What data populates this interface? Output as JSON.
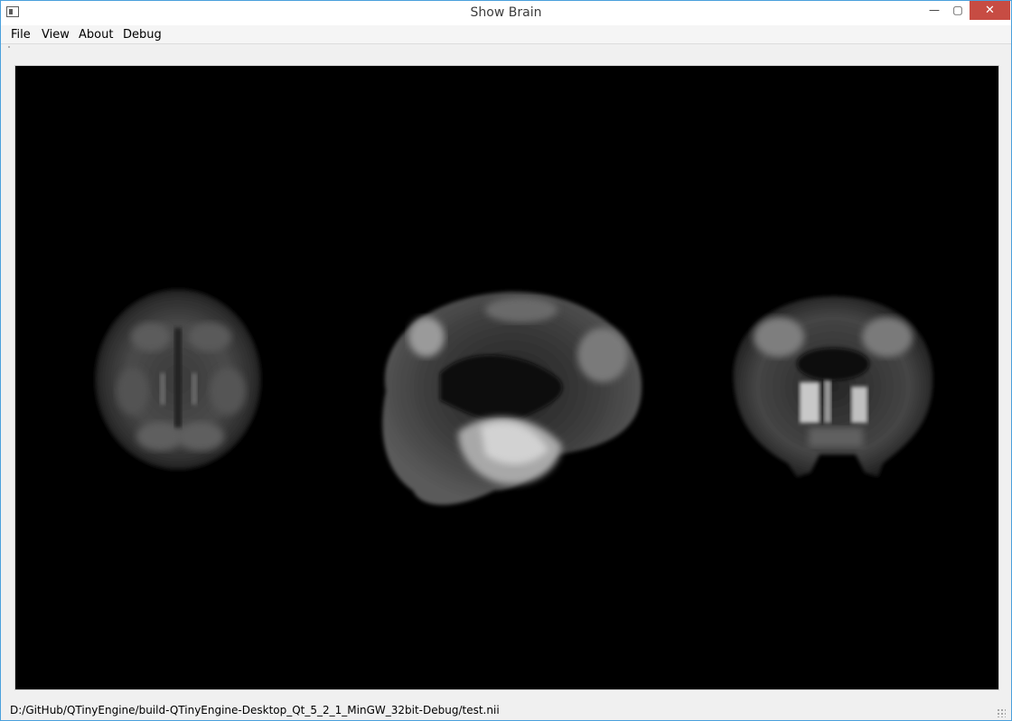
{
  "window": {
    "title": "Show Brain",
    "controls": {
      "minimize": "—",
      "maximize": "▢",
      "close": "✕"
    }
  },
  "menu": {
    "items": [
      "File",
      "View",
      "About",
      "Debug"
    ]
  },
  "viewer": {
    "background": "#000000",
    "views": [
      "axial-slice",
      "sagittal-slice",
      "coronal-slice"
    ]
  },
  "status": {
    "path": "D:/GitHub/QTinyEngine/build-QTinyEngine-Desktop_Qt_5_2_1_MinGW_32bit-Debug/test.nii"
  },
  "colors": {
    "close_button": "#c74c43",
    "window_border": "#4aa0dc"
  }
}
